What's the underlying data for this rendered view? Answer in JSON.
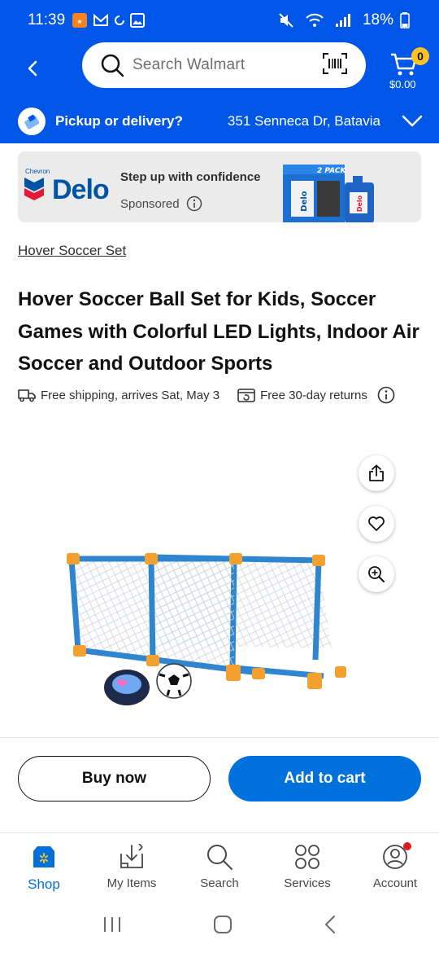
{
  "status_bar": {
    "time": "11:39",
    "battery": "18%"
  },
  "header": {
    "search_placeholder": "Search Walmart",
    "cart_count": "0",
    "cart_total": "$0.00"
  },
  "pickup": {
    "label": "Pickup or delivery?",
    "address": "351 Senneca Dr, Batavia"
  },
  "ad": {
    "brand": "Delo",
    "brand_small": "Chevron",
    "headline": "Step up with confidence",
    "sponsored": "Sponsored",
    "product_badge": "2 PACK"
  },
  "product": {
    "breadcrumb": "Hover Soccer Set",
    "title": "Hover Soccer Ball Set for Kids, Soccer Games with Colorful LED Lights, Indoor Air Soccer and Outdoor Sports",
    "shipping": "Free shipping, arrives Sat, May 3",
    "returns": "Free 30-day returns"
  },
  "actions": {
    "buy_now": "Buy now",
    "add_to_cart": "Add to cart"
  },
  "tabs": [
    {
      "label": "Shop",
      "icon": "shop-icon",
      "active": true
    },
    {
      "label": "My Items",
      "icon": "my-items-icon"
    },
    {
      "label": "Search",
      "icon": "search-icon"
    },
    {
      "label": "Services",
      "icon": "services-icon"
    },
    {
      "label": "Account",
      "icon": "account-icon"
    }
  ],
  "colors": {
    "brand_blue": "#0057e7",
    "button_blue": "#0071dc",
    "cart_badge": "#ffc220",
    "notification_dot": "#de1c24"
  }
}
